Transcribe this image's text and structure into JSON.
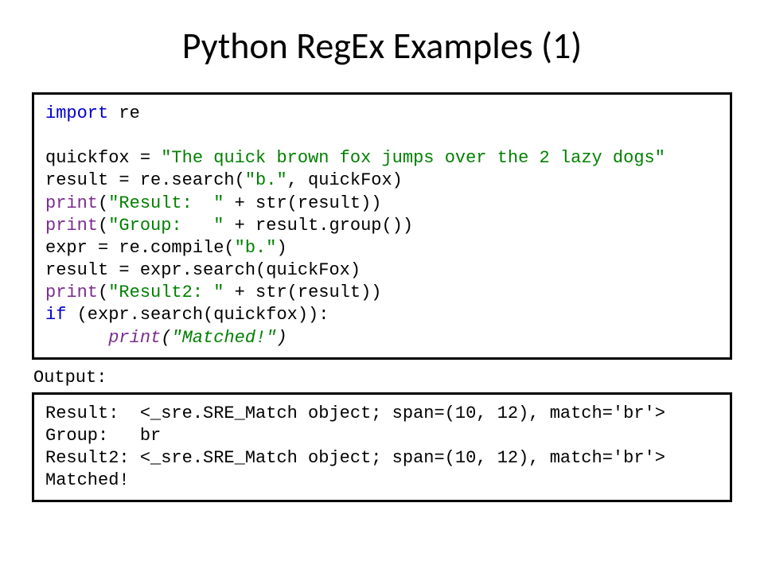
{
  "title": "Python RegEx Examples (1)",
  "code": {
    "l1_kw": "import",
    "l1_mod": " re",
    "blank1": "",
    "l2a": "quickfox = ",
    "l2b": "\"The quick brown fox jumps over the 2 lazy dogs\"",
    "l3a": "result = re.search(",
    "l3b": "\"b.\"",
    "l3c": ", quickFox)",
    "l4a": "print",
    "l4b": "(",
    "l4c": "\"Result:  \"",
    "l4d": " + str(result))",
    "l5a": "print",
    "l5b": "(",
    "l5c": "\"Group:   \"",
    "l5d": " + result.group())",
    "l6a": "expr = re.compile(",
    "l6b": "\"b.\"",
    "l6c": ")",
    "l7": "result = expr.search(quickFox)",
    "l8a": "print",
    "l8b": "(",
    "l8c": "\"Result2: \"",
    "l8d": " + str(result))",
    "l9a": "if",
    "l9b": " (expr.search(quickfox)):",
    "l10pad": "      ",
    "l10a": "print",
    "l10b": "(",
    "l10c": "\"Matched!\"",
    "l10d": ")"
  },
  "output_label": "Output:",
  "output": {
    "o1": "Result:  <_sre.SRE_Match object; span=(10, 12), match='br'>",
    "o2": "Group:   br",
    "o3": "Result2: <_sre.SRE_Match object; span=(10, 12), match='br'>",
    "o4": "Matched!"
  }
}
